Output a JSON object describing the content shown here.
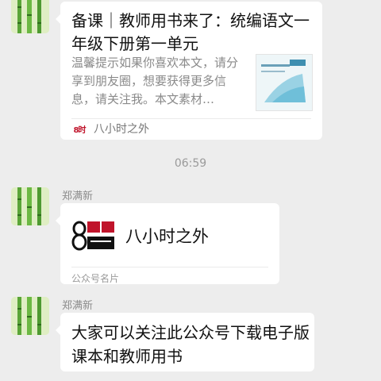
{
  "messages": [
    {
      "type": "article",
      "avatar_icon": "bamboo-avatar-icon",
      "title": "备课｜教师用书来了：统编语文一年级下册第一单元",
      "description": "温馨提示如果你喜欢本文，请分享到朋友圈，想要获得更多信息，请关注我。本文素材…",
      "thumbnail_icon": "book-cover-icon",
      "source_name": "八小时之外"
    },
    {
      "type": "timestamp",
      "text": "06:59"
    },
    {
      "type": "contact_card",
      "sender": "郑满新",
      "avatar_icon": "bamboo-avatar-icon",
      "card_title": "八小时之外",
      "card_label": "公众号名片",
      "logo_icon": "eight-hours-logo-icon"
    },
    {
      "type": "text",
      "sender": "郑满新",
      "avatar_icon": "bamboo-avatar-icon",
      "text": "大家可以关注此公众号下载电子版课本和教师用书"
    }
  ],
  "colors": {
    "background": "#ededed",
    "bubble": "#ffffff",
    "sender_name": "#8c8c8c",
    "logo_red": "#c0142b"
  }
}
